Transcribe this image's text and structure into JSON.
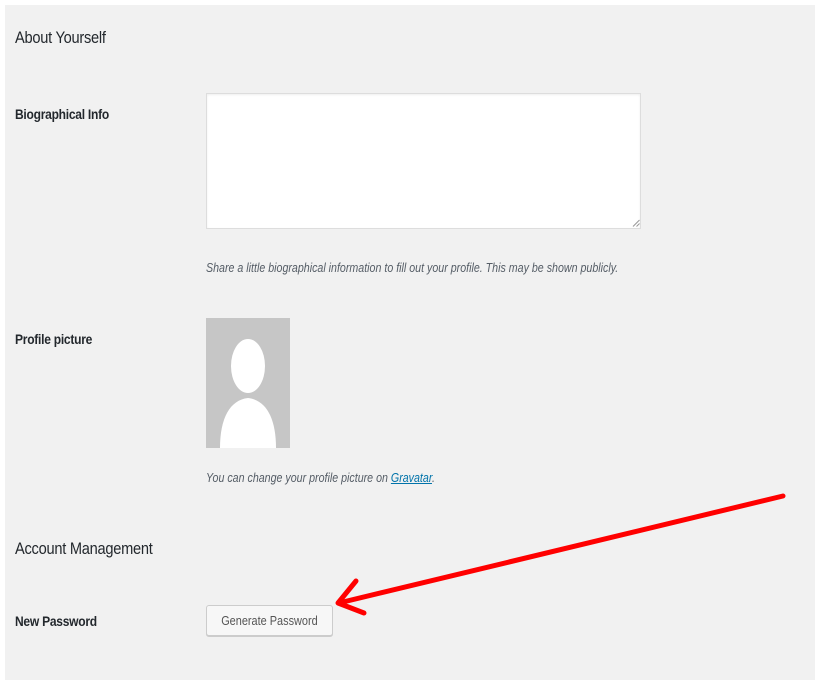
{
  "sections": {
    "about_yourself": "About Yourself",
    "account_management": "Account Management"
  },
  "biographical_info": {
    "label": "Biographical Info",
    "value": "",
    "description": "Share a little biographical information to fill out your profile. This may be shown publicly."
  },
  "profile_picture": {
    "label": "Profile picture",
    "description_prefix": "You can change your profile picture on ",
    "link_text": "Gravatar",
    "description_suffix": "."
  },
  "new_password": {
    "label": "New Password",
    "button_label": "Generate Password"
  },
  "annotation": {
    "arrow_color": "#ff0000",
    "target": "generate-password-button"
  },
  "colors": {
    "page_background": "#f1f1f1",
    "link": "#0073aa",
    "avatar_background": "#c6c6c6"
  },
  "icons": {
    "avatar": "default-person-silhouette",
    "annotation": "red-arrow"
  }
}
